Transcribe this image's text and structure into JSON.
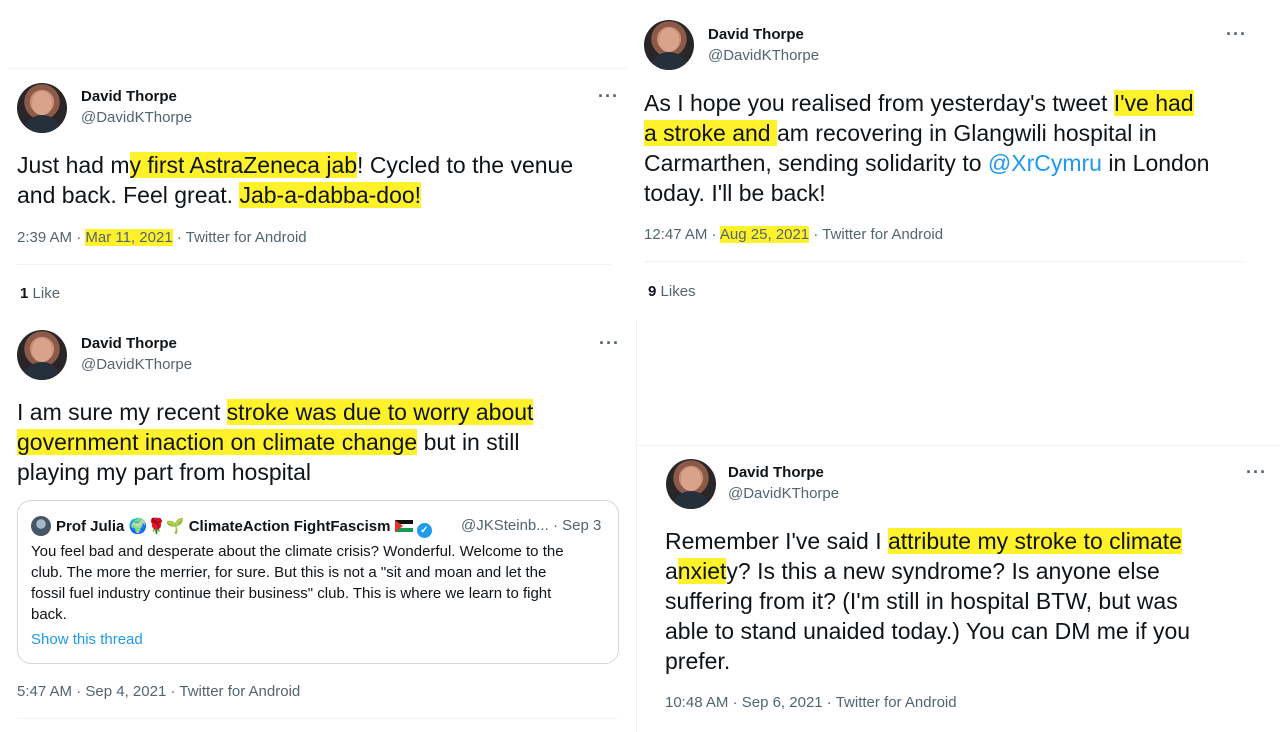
{
  "tweets": [
    {
      "name": "David Thorpe",
      "handle": "@DavidKThorpe",
      "more": "···",
      "lines": [
        [
          {
            "t": "Just had m"
          },
          {
            "t": "y first AstraZeneca jab",
            "h": true
          },
          {
            "t": "! Cycled to the venue"
          }
        ],
        [
          {
            "t": "and back. Feel great. "
          },
          {
            "t": "Jab-a-dabba-doo!",
            "h": true
          }
        ]
      ],
      "time": "2:39 AM",
      "date": "Mar 11, 2021",
      "source": "Twitter for Android",
      "likes_count": "1",
      "likes_label": "Like"
    },
    {
      "name": "David Thorpe",
      "handle": "@DavidKThorpe",
      "more": "···",
      "lines": [
        [
          {
            "t": "As I hope you realised from yesterday's tweet "
          },
          {
            "t": "I've had",
            "h": true
          }
        ],
        [
          {
            "t": "a stroke and ",
            "h": true
          },
          {
            "t": "am recovering in Glangwili hospital in"
          }
        ],
        [
          {
            "t": "Carmarthen, sending solidarity to "
          },
          {
            "t": "@XrCymru",
            "m": true
          },
          {
            "t": " in London"
          }
        ],
        [
          {
            "t": "today. I'll be back!"
          }
        ]
      ],
      "time": "12:47 AM",
      "date": "Aug 25, 2021",
      "source": "Twitter for Android",
      "likes_count": "9",
      "likes_label": "Likes"
    },
    {
      "name": "David Thorpe",
      "handle": "@DavidKThorpe",
      "more": "···",
      "lines": [
        [
          {
            "t": "I am sure my recent "
          },
          {
            "t": "stroke was due to worry about",
            "h": true
          }
        ],
        [
          {
            "t": "government inaction on climate change",
            "h": true
          },
          {
            "t": " but in still"
          }
        ],
        [
          {
            "t": "playing my part from hospital"
          }
        ]
      ],
      "quote": {
        "name": "Prof Julia 🌍🌹🌱 ClimateAction FightFascism",
        "handle": "@JKSteinb...",
        "date": "· Sep 3",
        "lines": [
          "You feel bad and desperate about the climate crisis? Wonderful. Welcome to the",
          "club. The more the merrier, for sure. But this is not a \"sit and moan and let the",
          "fossil fuel industry continue their business\" club. This is where we learn to fight",
          "back."
        ],
        "link": "Show this thread"
      },
      "time": "5:47 AM",
      "date": "Sep 4, 2021",
      "source": "Twitter for Android"
    },
    {
      "name": "David Thorpe",
      "handle": "@DavidKThorpe",
      "more": "···",
      "lines": [
        [
          {
            "t": "Remember I've said I "
          },
          {
            "t": "attribute my stroke to climate",
            "h": true
          }
        ],
        [
          {
            "t": "a"
          },
          {
            "t": "nxiet",
            "h": true
          },
          {
            "t": "y? Is this a new syndrome? Is anyone else"
          }
        ],
        [
          {
            "t": "suffering from it? (I'm still in hospital BTW, but was"
          }
        ],
        [
          {
            "t": "able to stand unaided today.) You can DM me if you"
          }
        ],
        [
          {
            "t": "prefer."
          }
        ]
      ],
      "time": "10:48 AM",
      "date": "Sep 6, 2021",
      "source": "Twitter for Android"
    }
  ],
  "colors": {
    "highlight": "#fff22b",
    "mention": "#1d9bf0",
    "secondary": "#536471"
  },
  "icons": [
    "more-icon",
    "verified-icon",
    "palestine-flag-icon"
  ]
}
